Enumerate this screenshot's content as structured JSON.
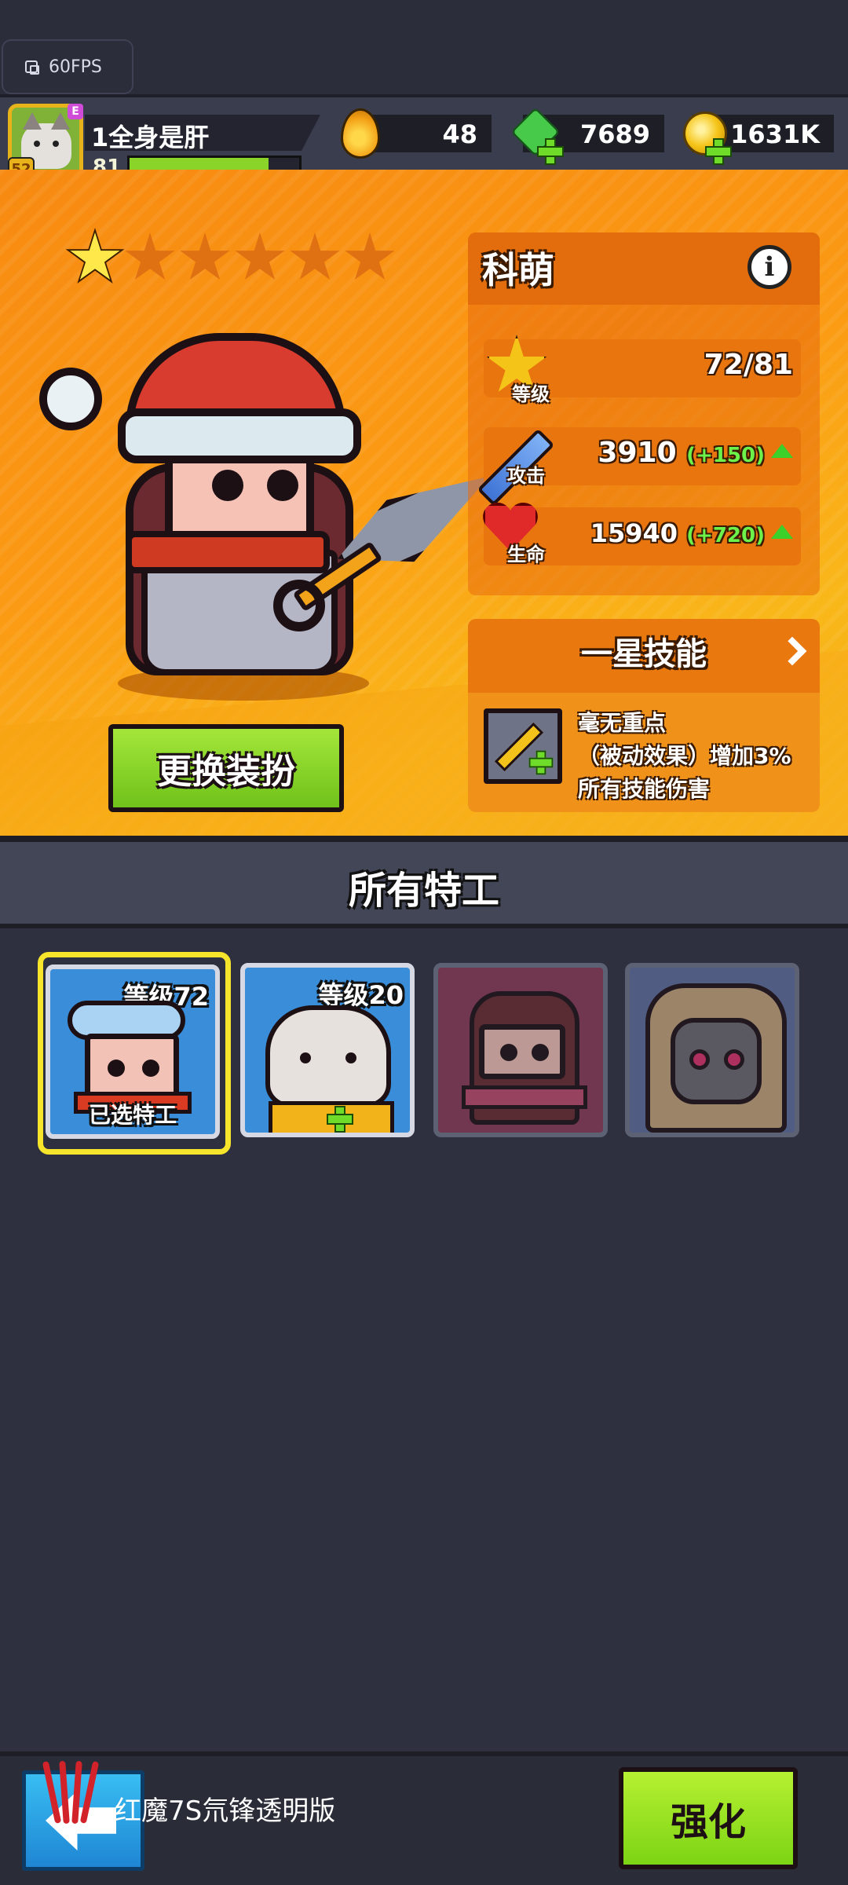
{
  "system": {
    "fps_label": "60FPS"
  },
  "player": {
    "name": "1全身是肝",
    "level": "81",
    "avatar_level": "52",
    "avatar_tag": "E",
    "xp_fraction": 0.82
  },
  "resources": {
    "energy": "48",
    "gems": "7689",
    "coins": "1631K"
  },
  "hero": {
    "name": "科萌",
    "stars_total": 6,
    "stars_filled": 1,
    "stats": {
      "level_label": "等级",
      "level_value": "72/81",
      "attack_label": "攻击",
      "attack_value": "3910",
      "attack_bonus": "(+150)",
      "hp_label": "生命",
      "hp_value": "15940",
      "hp_bonus": "(+720)"
    },
    "change_outfit_label": "更换装扮"
  },
  "skill": {
    "title": "一星技能",
    "desc_line1": "毫无重点",
    "desc_line2": "（被动效果）增加3%",
    "desc_line3": "所有技能伤害"
  },
  "agents": {
    "title": "所有特工",
    "cards": [
      {
        "level_label": "等级72",
        "status": "已选特工"
      },
      {
        "level_label": "等级20"
      },
      {
        "level_label": ""
      },
      {
        "level_label": ""
      }
    ]
  },
  "bottom": {
    "toast": "红魔7S氘锋透明版",
    "enhance_label": "强化"
  },
  "colors": {
    "panel_orange": "#f78a12",
    "button_green": "#7cd414",
    "selected_border": "#f6e52a"
  }
}
